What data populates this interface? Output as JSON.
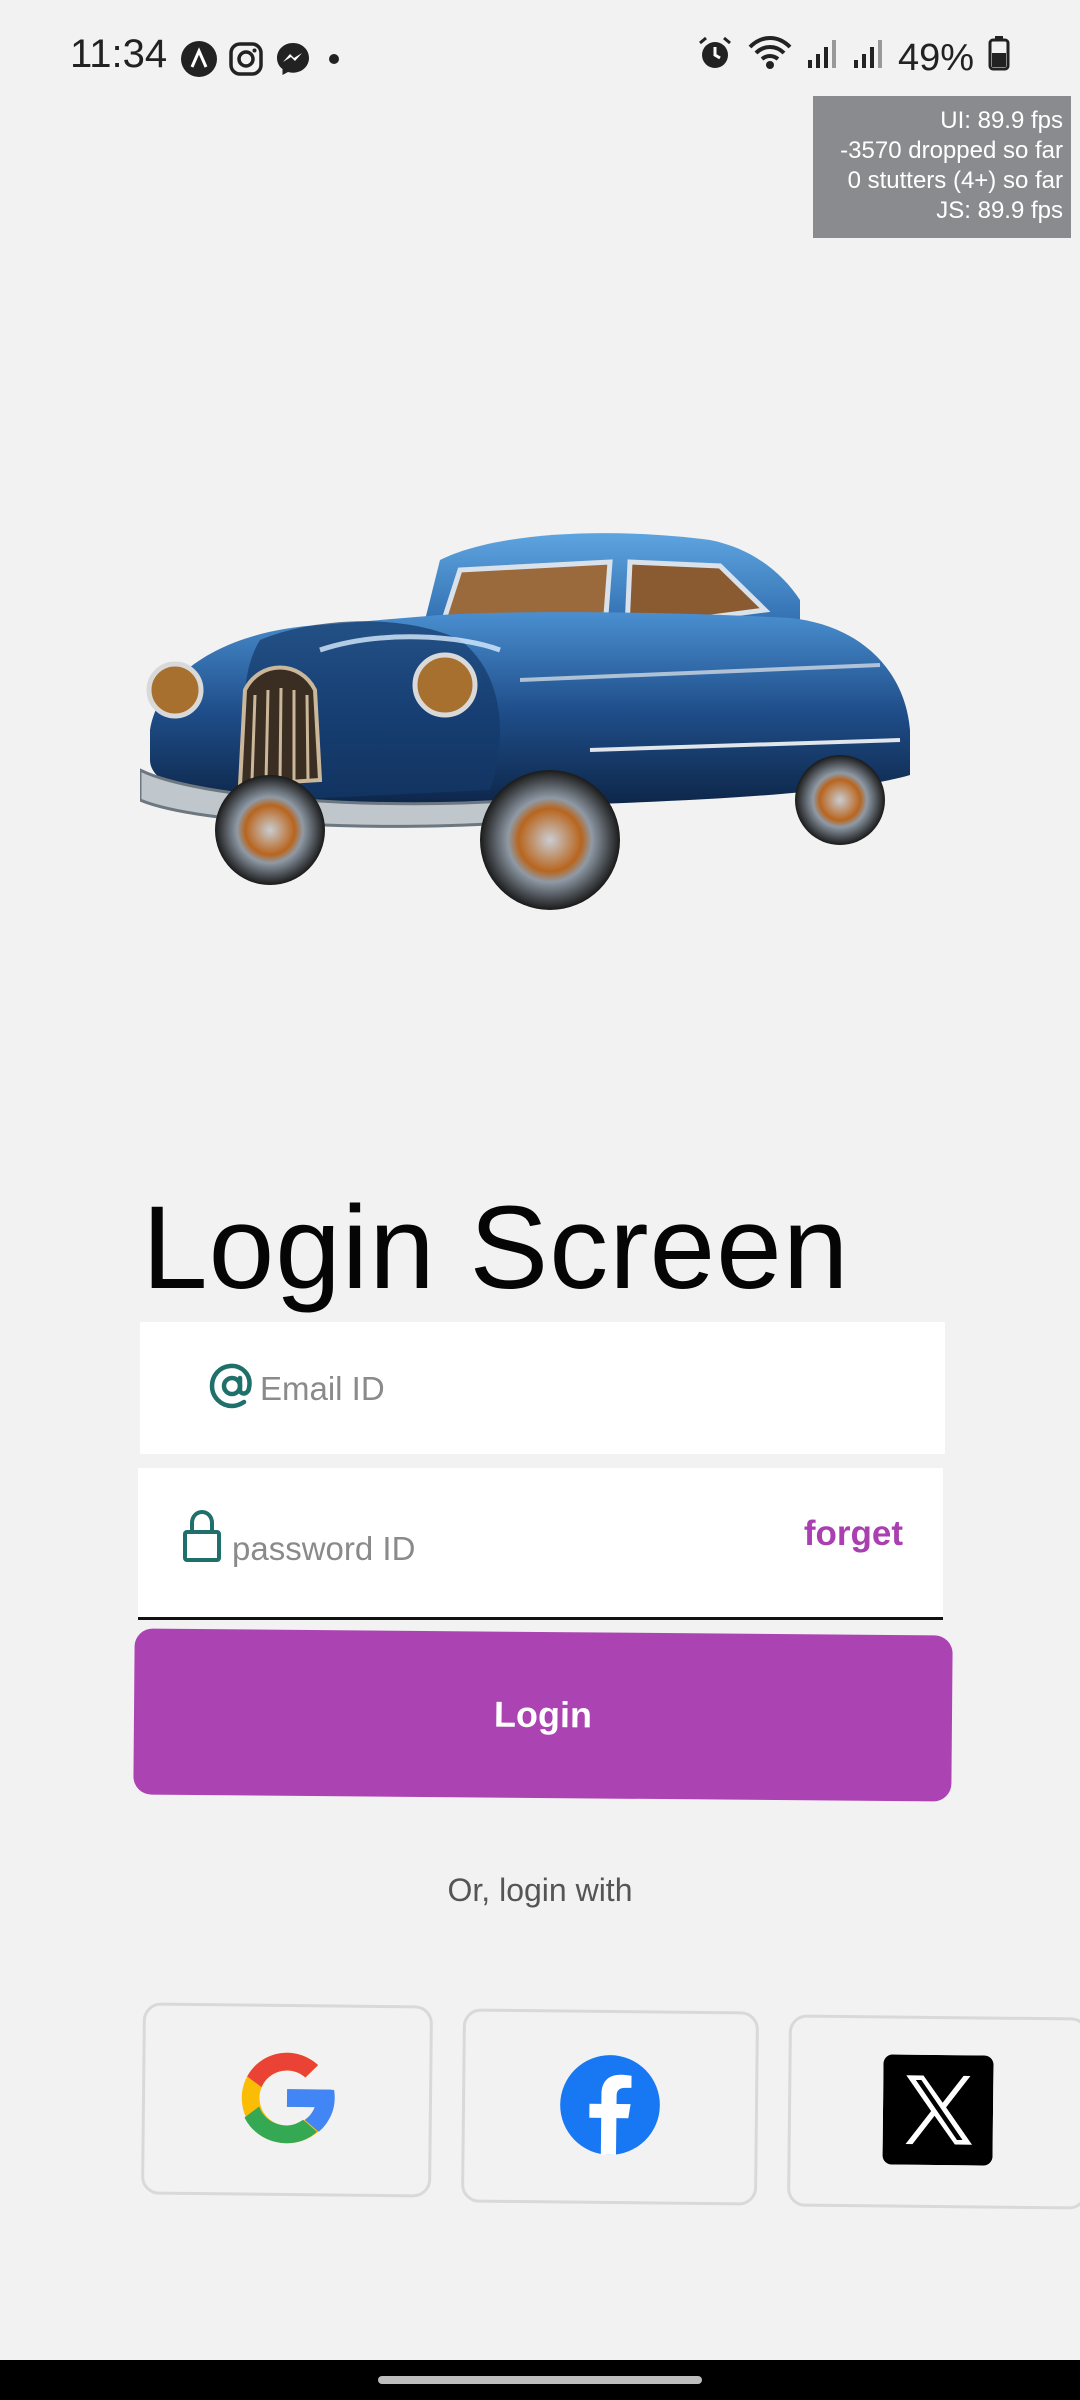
{
  "status_bar": {
    "time": "11:34",
    "battery_percent": "49%",
    "left_icons": [
      "arc-icon",
      "instagram-icon",
      "messenger-icon",
      "dot-icon"
    ],
    "right_icons": [
      "alarm-icon",
      "wifi-icon",
      "signal-icon",
      "signal-icon",
      "battery-icon"
    ]
  },
  "perf_overlay": {
    "line1": "UI: 89.9 fps",
    "line2": "-3570 dropped so far",
    "line3": "0 stutters (4+) so far",
    "line4": "JS: 89.9 fps"
  },
  "hero": {
    "image": "vintage-blue-car"
  },
  "login": {
    "title": "Login Screen",
    "email_placeholder": "Email ID",
    "password_placeholder": "password ID",
    "forget_label": "forget",
    "login_label": "Login",
    "or_text": "Or, login with"
  },
  "social": [
    "google-icon",
    "facebook-icon",
    "x-icon"
  ],
  "colors": {
    "accent": "#ac43b2",
    "forget": "#a93fb0",
    "icon_teal": "#1f6f6a",
    "background": "#f2f2f2"
  }
}
